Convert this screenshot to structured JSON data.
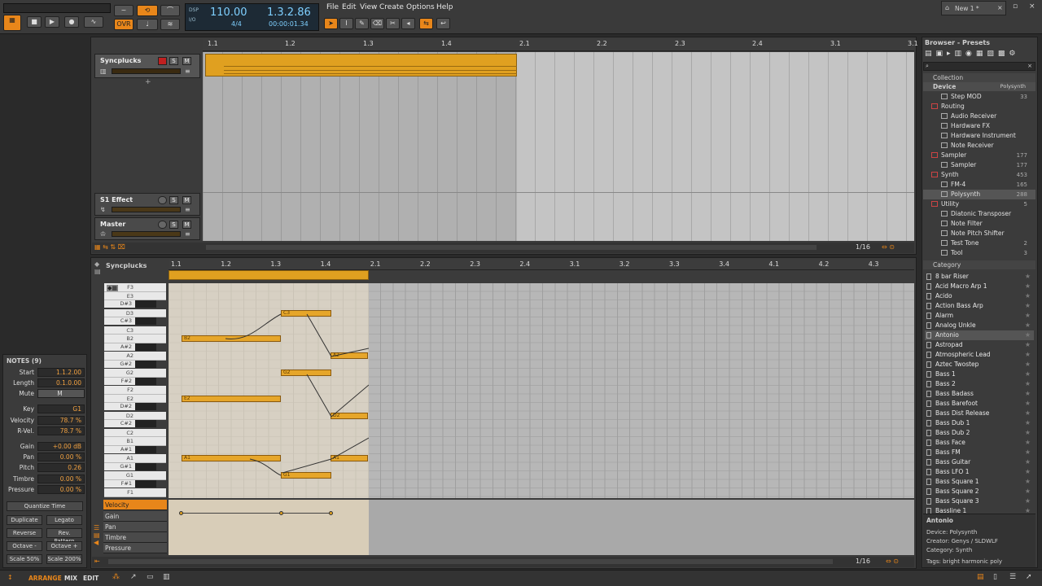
{
  "transport": {
    "tempo": "110.00",
    "signature": "4/4",
    "position": "1.3.2.86",
    "time": "00:00:01.34",
    "ovr": "OVR",
    "dsp": "DSP",
    "io": "I/O"
  },
  "menu": [
    "File",
    "Edit",
    "View",
    "Create",
    "Options",
    "Help"
  ],
  "project_tab": "New 1 *",
  "arranger": {
    "ruler": [
      "1.1",
      "1.2",
      "1.3",
      "1.4",
      "2.1",
      "2.2",
      "2.3",
      "2.4",
      "3.1",
      "3.1"
    ],
    "grid": "1/16"
  },
  "tracks": [
    {
      "name": "Syncplucks",
      "solo": "S",
      "mute": "M"
    },
    {
      "name": "S1 Effect",
      "solo": "S",
      "mute": "M"
    },
    {
      "name": "Master",
      "solo": "S",
      "mute": "M"
    }
  ],
  "editor": {
    "title": "Syncplucks",
    "ruler": [
      "1.1",
      "1.2",
      "1.3",
      "1.4",
      "2.1",
      "2.2",
      "2.3",
      "2.4",
      "3.1",
      "3.2",
      "3.3",
      "3.4",
      "4.1",
      "4.2",
      "4.3"
    ],
    "grid": "1/16"
  },
  "piano_keys": [
    "F3",
    "E3",
    "D#3",
    "D3",
    "C#3",
    "C3",
    "B2",
    "A#2",
    "A2",
    "G#2",
    "G2",
    "F#2",
    "F2",
    "E2",
    "D#2",
    "D2",
    "C#2",
    "C2",
    "B1",
    "A#1",
    "A1",
    "G#1",
    "G1",
    "F#1",
    "F1"
  ],
  "note_labels": [
    "C3",
    "B2",
    "A2",
    "G2",
    "E2",
    "D2",
    "A1",
    "A1",
    "G1",
    "A1"
  ],
  "expression_tabs": [
    "Velocity",
    "Gain",
    "Pan",
    "Timbre",
    "Pressure"
  ],
  "inspector": {
    "title": "NOTES (9)",
    "start": "1.1.2.00",
    "length": "0.1.0.00",
    "mute": "M",
    "key": "G1",
    "velocity": "78.7 %",
    "rvel": "78.7 %",
    "gain": "+0.00 dB",
    "pan": "0.00 %",
    "pitch": "0.26",
    "timbre": "0.00 %",
    "pressure": "0.00 %",
    "labels": {
      "start": "Start",
      "length": "Length",
      "mute": "Mute",
      "key": "Key",
      "velocity": "Velocity",
      "rvel": "R-Vel.",
      "gain": "Gain",
      "pan": "Pan",
      "pitch": "Pitch",
      "timbre": "Timbre",
      "pressure": "Pressure"
    },
    "buttons": [
      "Quantize Time",
      "Duplicate",
      "Legato",
      "Reverse",
      "Rev. Pattern",
      "Octave -",
      "Octave +",
      "Scale 50%",
      "Scale 200%"
    ]
  },
  "browser": {
    "title": "Browser - Presets",
    "collection": "Collection",
    "device": "Device",
    "device_filter": "Polysynth",
    "tree": [
      {
        "label": "Step MOD",
        "count": "33",
        "indent": 2
      },
      {
        "label": "Routing",
        "count": "",
        "indent": 1
      },
      {
        "label": "Audio Receiver",
        "count": "",
        "indent": 2
      },
      {
        "label": "Hardware FX",
        "count": "",
        "indent": 2
      },
      {
        "label": "Hardware Instrument",
        "count": "",
        "indent": 2
      },
      {
        "label": "Note Receiver",
        "count": "",
        "indent": 2
      },
      {
        "label": "Sampler",
        "count": "177",
        "indent": 1
      },
      {
        "label": "Sampler",
        "count": "177",
        "indent": 2
      },
      {
        "label": "Synth",
        "count": "453",
        "indent": 1
      },
      {
        "label": "FM-4",
        "count": "165",
        "indent": 2
      },
      {
        "label": "Polysynth",
        "count": "288",
        "indent": 2
      },
      {
        "label": "Utility",
        "count": "5",
        "indent": 1
      },
      {
        "label": "Diatonic Transposer",
        "count": "",
        "indent": 2
      },
      {
        "label": "Note Filter",
        "count": "",
        "indent": 2
      },
      {
        "label": "Note Pitch Shifter",
        "count": "",
        "indent": 2
      },
      {
        "label": "Test Tone",
        "count": "2",
        "indent": 2
      },
      {
        "label": "Tool",
        "count": "3",
        "indent": 2
      }
    ],
    "category_title": "Category",
    "presets": [
      "8 bar Riser",
      "Acid Macro Arp 1",
      "Acido",
      "Action Bass Arp",
      "Alarm",
      "Analog Unkle",
      "Antonio",
      "Astropad",
      "Atmospheric Lead",
      "Aztec Twostep",
      "Bass 1",
      "Bass 2",
      "Bass Badass",
      "Bass Barefoot",
      "Bass Dist Release",
      "Bass Dub 1",
      "Bass Dub 2",
      "Bass Face",
      "Bass FM",
      "Bass Guitar",
      "Bass LFO 1",
      "Bass Square 1",
      "Bass Square 2",
      "Bass Square 3",
      "Bassline 1"
    ],
    "info": {
      "name": "Antonio",
      "device": "Device: Polysynth",
      "creator": "Creator: Genys / SLDWLF",
      "category": "Category: Synth",
      "tags": "Tags: bright harmonic poly"
    }
  },
  "bottom": {
    "arrange": "ARRANGE",
    "mix": "MIX",
    "edit": "EDIT"
  },
  "colors": {
    "accent": "#e8861a",
    "clip": "#e0a020",
    "grid": "#b7b7b7"
  }
}
